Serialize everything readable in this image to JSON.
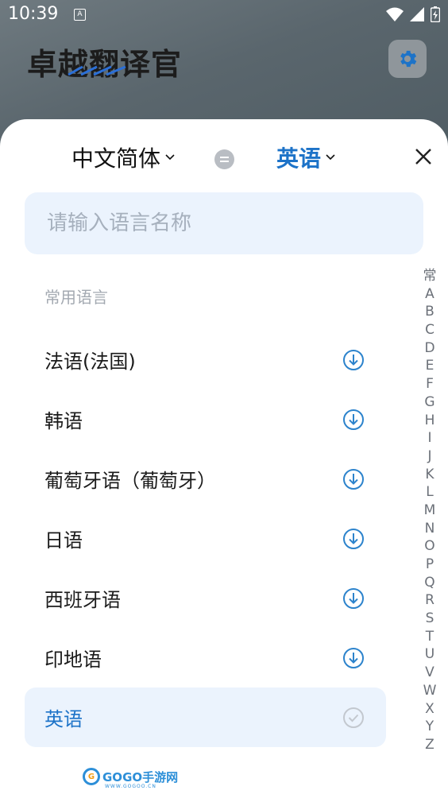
{
  "status_bar": {
    "time": "10:39",
    "notif_glyph": "A"
  },
  "app": {
    "title": "卓越翻译官"
  },
  "sheet": {
    "source_language": "中文简体",
    "target_language": "英语",
    "search_placeholder": "请输入语言名称",
    "section_label": "常用语言",
    "languages": [
      {
        "label": "法语(法国)",
        "state": "download"
      },
      {
        "label": "韩语",
        "state": "download"
      },
      {
        "label": "葡萄牙语（葡萄牙）",
        "state": "download"
      },
      {
        "label": "日语",
        "state": "download"
      },
      {
        "label": "西班牙语",
        "state": "download"
      },
      {
        "label": "印地语",
        "state": "download"
      },
      {
        "label": "英语",
        "state": "selected"
      }
    ],
    "alpha_index": [
      "常",
      "A",
      "B",
      "C",
      "D",
      "E",
      "F",
      "G",
      "H",
      "I",
      "J",
      "K",
      "L",
      "M",
      "N",
      "O",
      "P",
      "Q",
      "R",
      "S",
      "T",
      "U",
      "V",
      "W",
      "X",
      "Y",
      "Z"
    ]
  },
  "watermark": {
    "text": "GOGO手游网",
    "sub": "WWW.GOGOO.CN"
  },
  "colors": {
    "accent": "#1d73c8",
    "search_bg": "#ebf3fd",
    "icon_blue": "#2c83cc"
  }
}
